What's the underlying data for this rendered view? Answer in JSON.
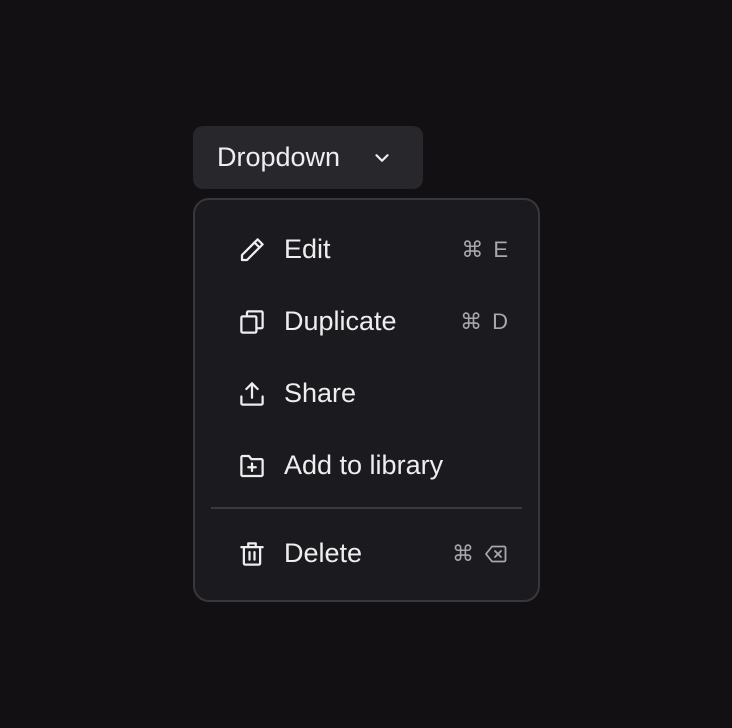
{
  "trigger": {
    "label": "Dropdown",
    "icon": "chevron-down-icon"
  },
  "menu": {
    "items": [
      {
        "label": "Edit",
        "icon": "pencil-icon",
        "shortcut_key": "E",
        "shortcut_modifier": "⌘"
      },
      {
        "label": "Duplicate",
        "icon": "copy-icon",
        "shortcut_key": "D",
        "shortcut_modifier": "⌘"
      },
      {
        "label": "Share",
        "icon": "share-upload-icon"
      },
      {
        "label": "Add to library",
        "icon": "folder-plus-icon"
      },
      {
        "label": "Delete",
        "icon": "trash-icon",
        "shortcut_modifier": "⌘",
        "shortcut_key_icon": "backspace-icon"
      }
    ]
  },
  "colors": {
    "background": "#121013",
    "trigger_bg": "#28272b",
    "menu_bg": "#1b1a1e",
    "menu_border": "#38373c",
    "text": "#eeeeef",
    "shortcut_text": "#a8a7ac"
  }
}
